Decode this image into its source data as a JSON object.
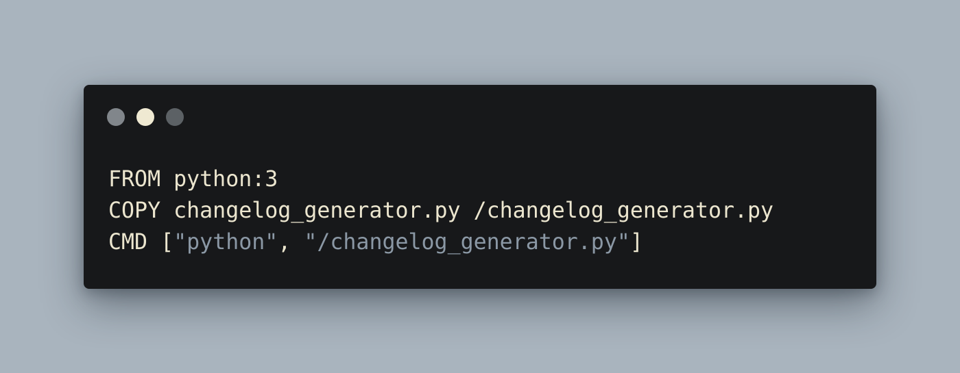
{
  "colors": {
    "dot_1": "#81868b",
    "dot_2": "#efe9d2",
    "dot_3": "#5c6165",
    "foreground": "#ece6cf",
    "string": "#8b98a5"
  },
  "window": {
    "controls": [
      {
        "name": "window-dot-1"
      },
      {
        "name": "window-dot-2"
      },
      {
        "name": "window-dot-3"
      }
    ]
  },
  "code": {
    "lines": [
      {
        "keyword": "FROM",
        "rest": " python:3"
      },
      {
        "keyword": "COPY",
        "rest": " changelog_generator.py /changelog_generator.py"
      },
      {
        "keyword": "CMD",
        "open": " [",
        "arg1": "\"python\"",
        "sep": ", ",
        "arg2": "\"/changelog_generator.py\"",
        "close": "]"
      }
    ]
  }
}
